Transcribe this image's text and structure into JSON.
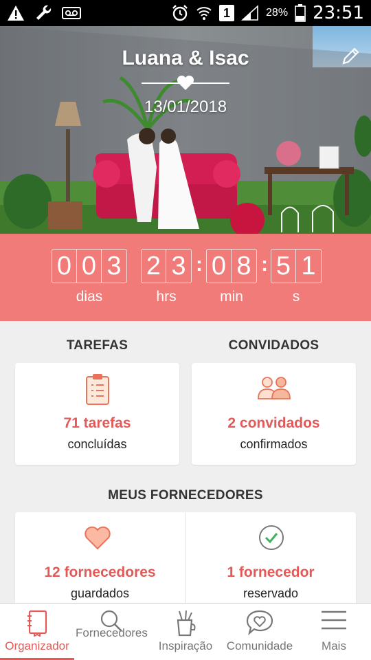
{
  "status_bar": {
    "battery_percent": "28%",
    "time": "23:51",
    "sim_slot": "1"
  },
  "hero": {
    "couple_names": "Luana & Isac",
    "wedding_date": "13/01/2018"
  },
  "countdown": {
    "days": "003",
    "hours": "23",
    "minutes": "08",
    "seconds": "51",
    "labels": {
      "days": "dias",
      "hours": "hrs",
      "minutes": "min",
      "seconds": "s"
    }
  },
  "tasks": {
    "title": "TAREFAS",
    "count_text": "71 tarefas",
    "sub_text": "concluídas"
  },
  "guests": {
    "title": "CONVIDADOS",
    "count_text": "2 convidados",
    "sub_text": "confirmados"
  },
  "vendors": {
    "title": "MEUS FORNECEDORES",
    "saved": {
      "count_text": "12 fornecedores",
      "sub_text": "guardados"
    },
    "booked": {
      "count_text": "1 fornecedor",
      "sub_text": "reservado"
    }
  },
  "bottom_nav": {
    "items": [
      {
        "label": "Organizador",
        "icon": "notebook-icon",
        "active": true
      },
      {
        "label": "Fornecedores",
        "icon": "search-icon",
        "active": false
      },
      {
        "label": "Inspiração",
        "icon": "pencil-cup-icon",
        "active": false
      },
      {
        "label": "Comunidade",
        "icon": "chat-heart-icon",
        "active": false
      },
      {
        "label": "Mais",
        "icon": "menu-icon",
        "active": false
      }
    ]
  },
  "colors": {
    "accent": "#f07b78",
    "accent_text": "#e25a58",
    "background": "#efefef"
  }
}
